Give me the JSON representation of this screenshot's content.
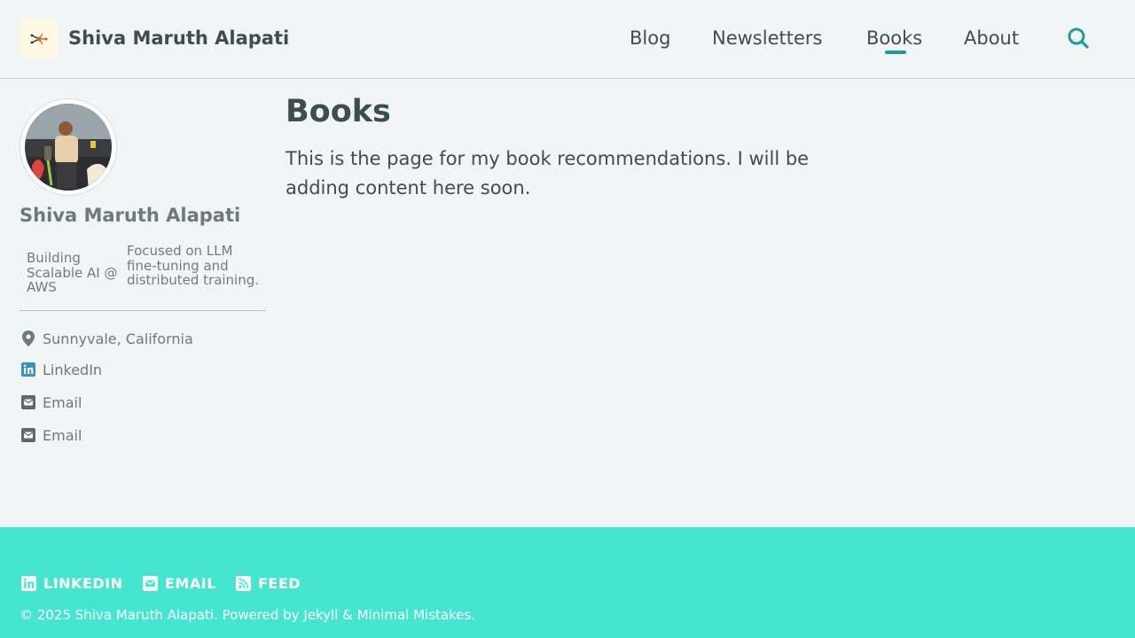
{
  "header": {
    "site_title": "Shiva Maruth Alapati",
    "nav": [
      {
        "label": "Blog"
      },
      {
        "label": "Newsletters"
      },
      {
        "label": "Books",
        "active": true
      },
      {
        "label": "About"
      }
    ],
    "search_icon": "search-icon",
    "logo_icon": "network-nodes-logo",
    "accent_color": "#20999b"
  },
  "sidebar": {
    "author_name": "Shiva Maruth Alapati",
    "bio_left": "Building Scalable AI @ AWS",
    "bio_right": "Focused on LLM fine-tuning and distributed training.",
    "location": "Sunnyvale, California",
    "links": [
      {
        "label": "LinkedIn",
        "icon": "linkedin-icon"
      },
      {
        "label": "Email",
        "icon": "email-icon"
      },
      {
        "label": "Email",
        "icon": "email-icon"
      }
    ]
  },
  "main": {
    "title": "Books",
    "body": "This is the page for my book recommendations. I will be adding content here soon."
  },
  "footer": {
    "links": [
      {
        "label": "LINKEDIN",
        "icon": "linkedin-icon"
      },
      {
        "label": "EMAIL",
        "icon": "email-icon"
      },
      {
        "label": "FEED",
        "icon": "rss-feed-icon"
      }
    ],
    "copyright": "© 2025 Shiva Maruth Alapati. Powered by Jekyll & Minimal Mistakes.",
    "background_color": "#46e5cf"
  }
}
